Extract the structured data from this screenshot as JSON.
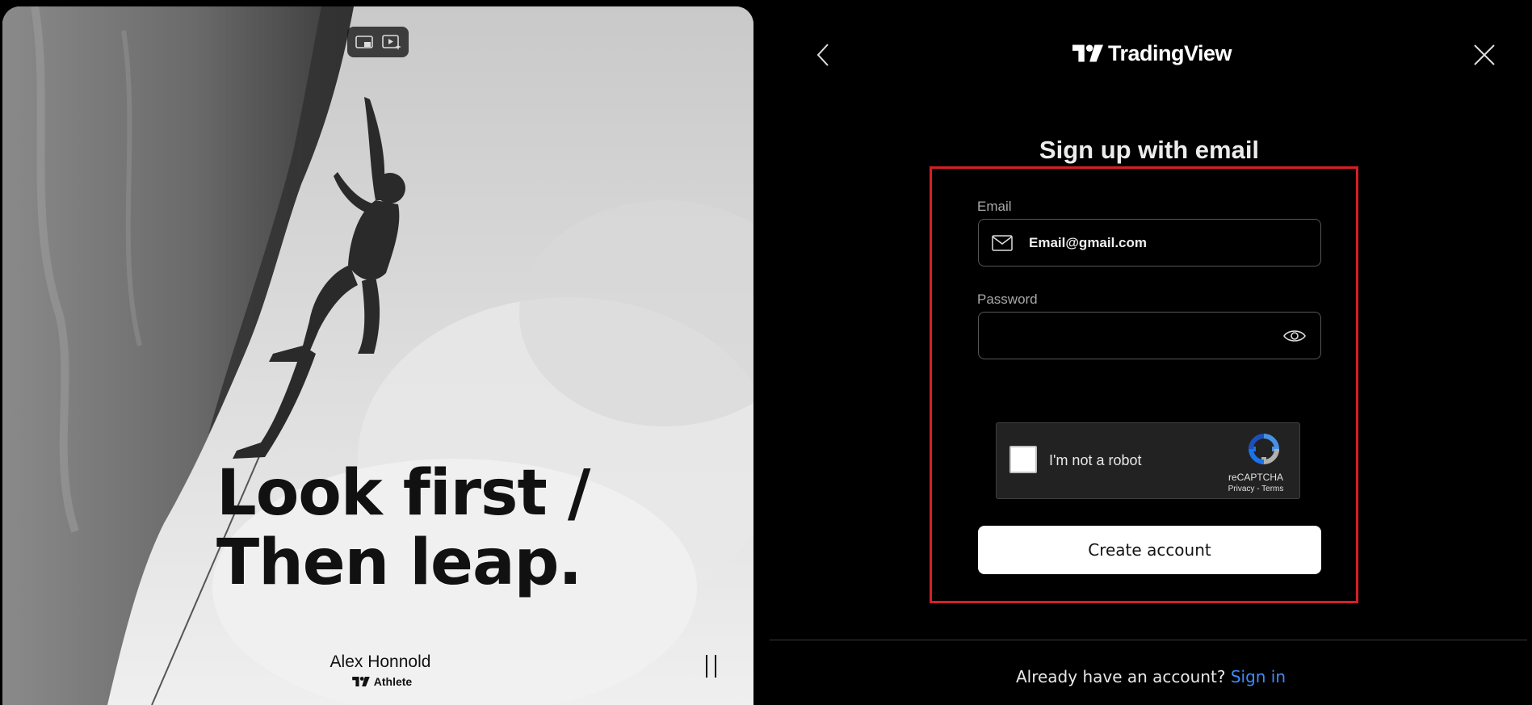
{
  "hero": {
    "headline_line1": "Look first /",
    "headline_line2": "Then leap.",
    "credit_name": "Alex Honnold",
    "credit_role": "Athlete"
  },
  "header": {
    "brand_name": "TradingView"
  },
  "form": {
    "title": "Sign up with email",
    "email_label": "Email",
    "email_value": "Email@gmail.com",
    "password_label": "Password",
    "password_value": "",
    "submit_label": "Create account"
  },
  "captcha": {
    "label": "I'm not a robot",
    "brand": "reCAPTCHA",
    "links": "Privacy - Terms"
  },
  "footer": {
    "prompt": "Already have an account?",
    "signin_label": "Sign in"
  },
  "colors": {
    "background": "#000000",
    "highlight_border": "#d61f26",
    "link": "#3d8bff",
    "button_bg": "#ffffff"
  },
  "icons": [
    "picture-in-picture-icon",
    "video-sparkle-icon",
    "pause-icon",
    "back-chevron-icon",
    "close-icon",
    "tradingview-logo",
    "mail-icon",
    "eye-icon",
    "recaptcha-logo"
  ]
}
